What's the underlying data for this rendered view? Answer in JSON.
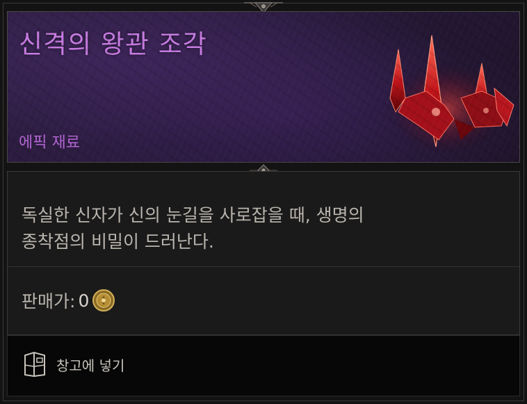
{
  "item": {
    "name": "신격의 왕관 조각",
    "type": "에픽 재료",
    "description_line1": "독실한 신자가 신의 눈길을 사로잡을 때, 생명의",
    "description_line2": "종착점의 비밀이 드러난다.",
    "sell_label": "판매가:",
    "sell_value": "0",
    "icon": "crimson-crown-shard",
    "rarity_color": "#c57be0"
  },
  "actions": {
    "stash_label": "창고에 넣기",
    "stash_icon": "stash-chest-icon"
  },
  "colors": {
    "header_bg": "#2b1d3e",
    "body_bg": "#1b1a1a",
    "footer_bg": "#070707",
    "text": "#b9b5ae"
  }
}
